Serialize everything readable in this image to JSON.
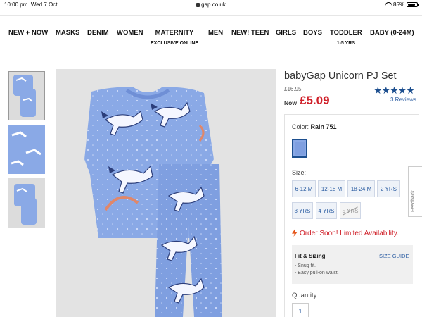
{
  "status_bar": {
    "time": "10:00 pm",
    "date": "Wed 7 Oct",
    "url": "gap.co.uk",
    "battery": "85%",
    "battery_level": 0.85
  },
  "nav": [
    {
      "label": "NEW + NOW"
    },
    {
      "label": "MASKS"
    },
    {
      "label": "DENIM"
    },
    {
      "label": "WOMEN"
    },
    {
      "label": "MATERNITY",
      "sub": "EXCLUSIVE ONLINE"
    },
    {
      "label": "MEN"
    },
    {
      "label": "NEW! TEEN"
    },
    {
      "label": "GIRLS"
    },
    {
      "label": "BOYS"
    },
    {
      "label": "TODDLER",
      "sub": "1-5 YRS"
    },
    {
      "label": "BABY (0-24M)"
    }
  ],
  "product": {
    "title": "babyGap Unicorn PJ Set",
    "old_price": "£16.95",
    "now_label": "Now",
    "now_price": "£5.09",
    "stars": "★★★★★",
    "rating": 5,
    "reviews": "3 Reviews",
    "color_label": "Color:",
    "color_value": "Rain 751",
    "size_label": "Size:",
    "sizes": [
      {
        "label": "6-12 M",
        "available": true
      },
      {
        "label": "12-18 M",
        "available": true
      },
      {
        "label": "18-24 M",
        "available": true
      },
      {
        "label": "2 YRS",
        "available": true
      },
      {
        "label": "3 YRS",
        "available": true
      },
      {
        "label": "4 YRS",
        "available": true
      },
      {
        "label": "5 YRS",
        "available": false
      }
    ],
    "order_notice": "Order Soon! Limited Availability.",
    "fit_title": "Fit & Sizing",
    "size_guide": "SIZE GUIDE",
    "fit_points": [
      "- Snug fit.",
      "- Easy pull-on waist."
    ],
    "quantity_label": "Quantity:",
    "quantity": "1"
  },
  "feedback_label": "Feedback",
  "colors": {
    "accent": "#1d4f8f",
    "sale": "#d0212a",
    "pj_blue": "#8aa9e6"
  }
}
